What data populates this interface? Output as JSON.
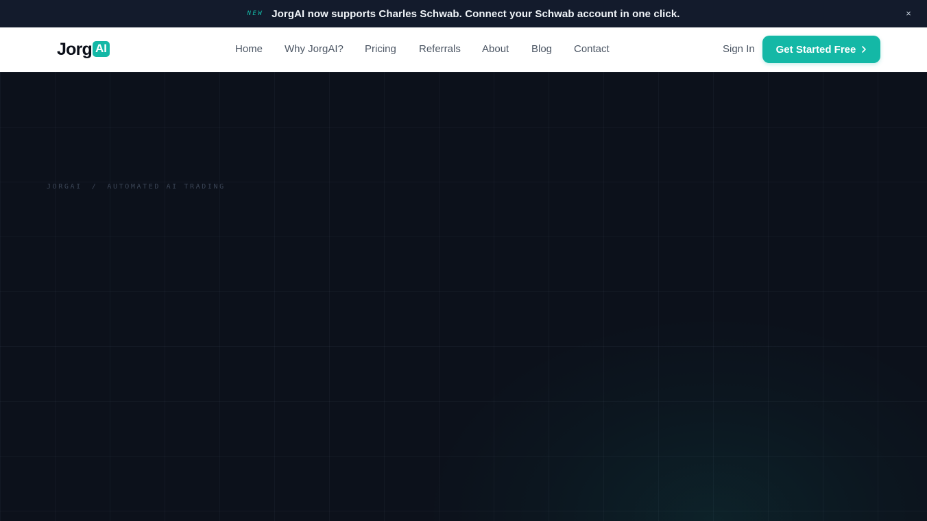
{
  "announcement": {
    "badge": "NEW",
    "message": "JorgAI now supports Charles Schwab. Connect your Schwab account in one click.",
    "close_label": "×"
  },
  "brand": {
    "word": "Jorg",
    "ai_mark": "AI",
    "accent_color": "#14b8a6"
  },
  "nav": {
    "items": [
      {
        "label": "Home"
      },
      {
        "label": "Why JorgAI?"
      },
      {
        "label": "Pricing"
      },
      {
        "label": "Referrals"
      },
      {
        "label": "About"
      },
      {
        "label": "Blog"
      },
      {
        "label": "Contact"
      }
    ],
    "sign_in": "Sign In",
    "cta": "Get Started Free",
    "cta_icon": "chevron-right-icon"
  },
  "hero": {
    "breadcrumb": {
      "first": "JORGAI",
      "separator": "/",
      "second": "AUTOMATED AI TRADING"
    }
  }
}
